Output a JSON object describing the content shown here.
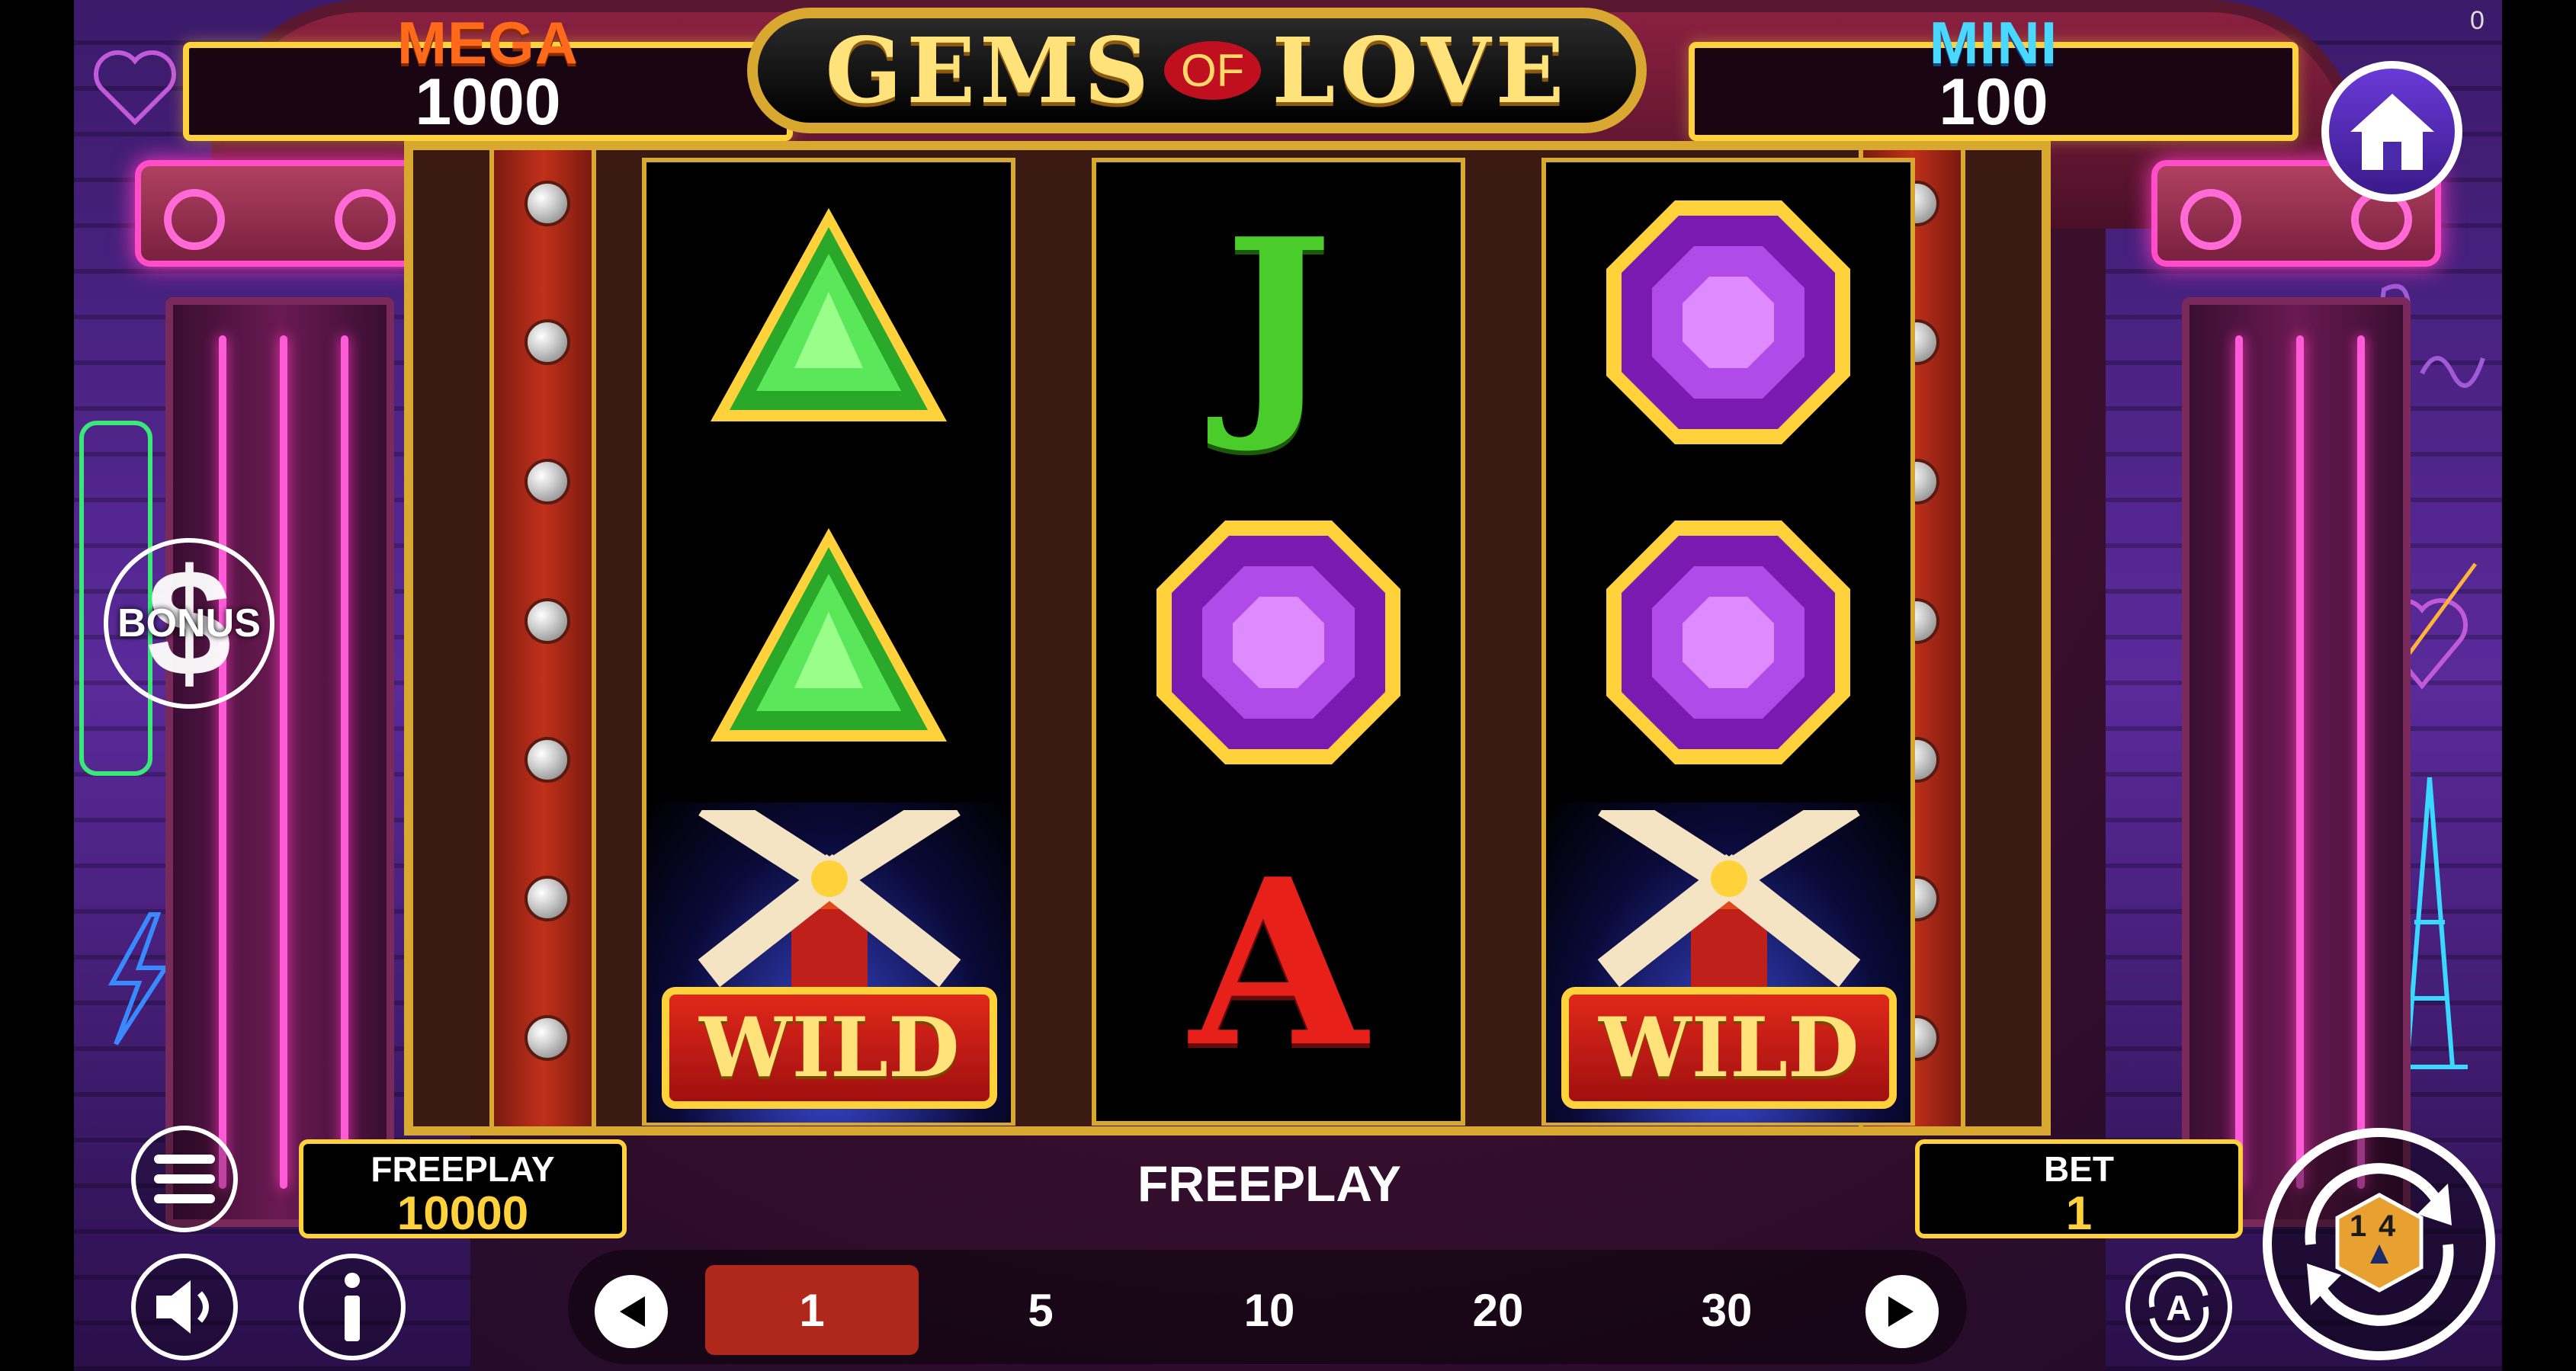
{
  "jackpots": {
    "mega": {
      "label": "MEGA",
      "value": "1000"
    },
    "mini": {
      "label": "MINI",
      "value": "100"
    }
  },
  "logo": {
    "word1": "GEMS",
    "word2": "OF",
    "word3": "LOVE"
  },
  "reels": [
    {
      "symbols": [
        "green-triangle-gem",
        "green-triangle-gem",
        "windmill-wild"
      ]
    },
    {
      "symbols": [
        "J",
        "purple-octagon-gem",
        "A"
      ]
    },
    {
      "symbols": [
        "purple-octagon-gem",
        "purple-octagon-gem",
        "windmill-wild"
      ]
    }
  ],
  "wild_label": "WILD",
  "bonus_button": {
    "label": "BONUS"
  },
  "freeplay_box": {
    "label": "FREEPLAY",
    "value": "10000"
  },
  "center_message": "FREEPLAY",
  "bet_box": {
    "label": "BET",
    "value": "1"
  },
  "bet_options": [
    "1",
    "5",
    "10",
    "20",
    "30"
  ],
  "selected_bet": "1",
  "spin_counter": {
    "top": "1",
    "bottom": "4"
  },
  "corner_counter": "0",
  "colors": {
    "gold": "#ffd23c",
    "neon_pink": "#ff5ad8",
    "selected_bet": "#b0281a",
    "mega": "#ff6a1a",
    "mini": "#4ad8ff"
  }
}
